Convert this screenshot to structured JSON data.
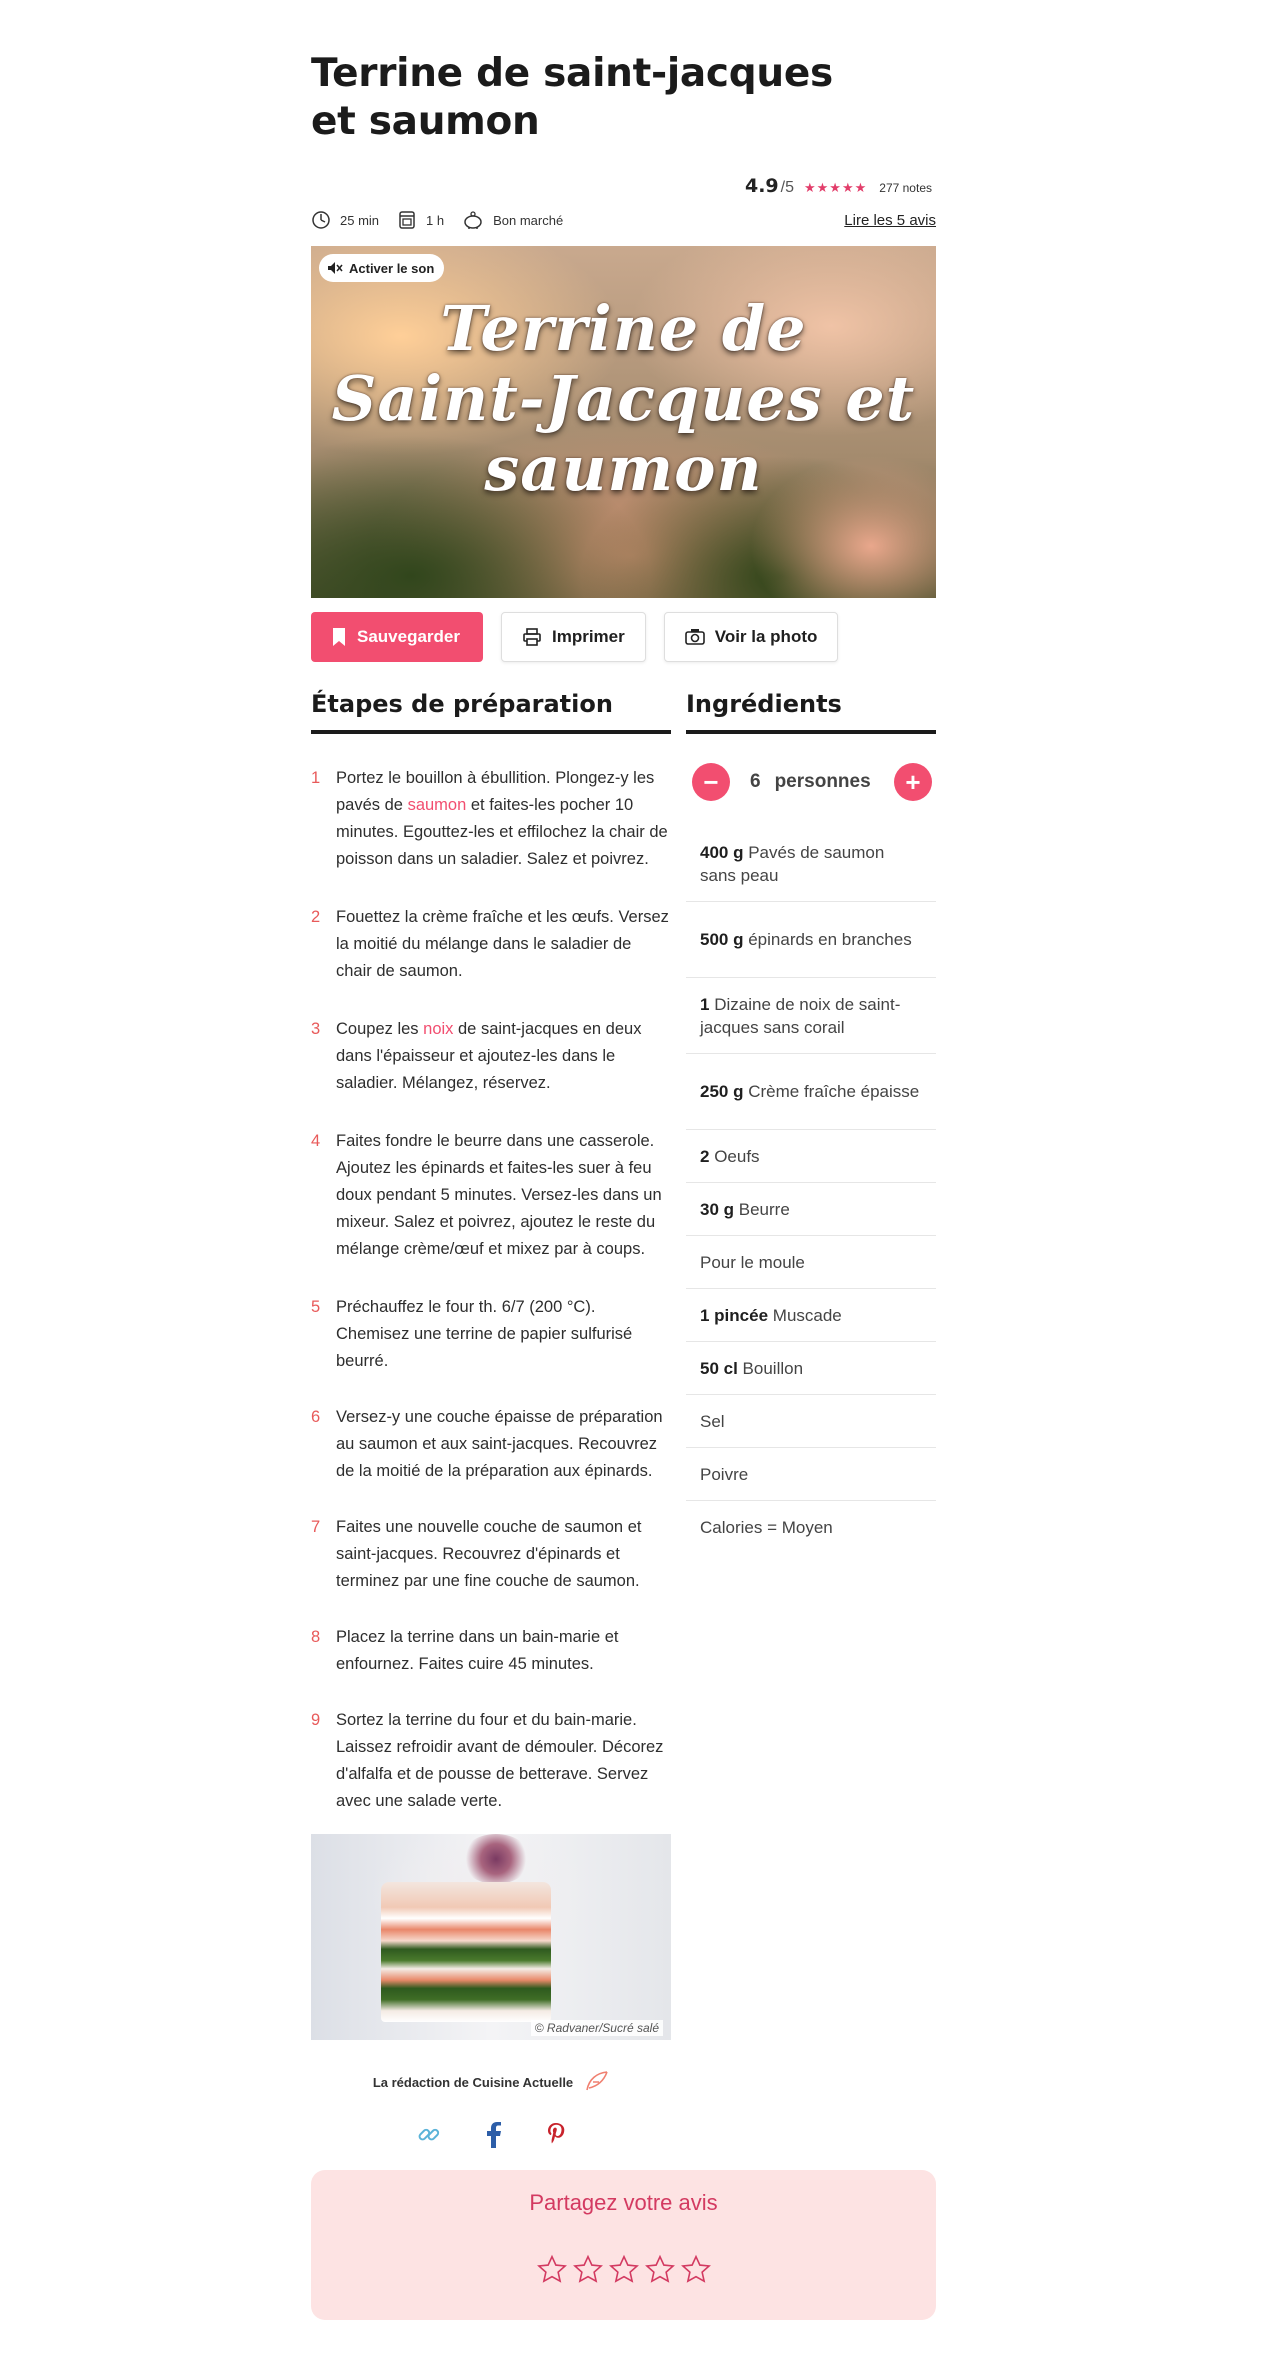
{
  "recipe": {
    "title": "Terrine de saint-jacques et saumon",
    "rating": {
      "score": "4.9",
      "out_of": "/5",
      "stars_count": 5,
      "notes": "277 notes"
    },
    "meta": {
      "prep_time": "25 min",
      "cook_time": "1 h",
      "price": "Bon marché",
      "reviews_link": "Lire les 5 avis"
    }
  },
  "video": {
    "sound_button": "Activer le son",
    "overlay_title": "Terrine de Saint-Jacques et saumon",
    "overlay_lines": [
      "Terrine de",
      "Saint-Jacques et",
      "saumon"
    ]
  },
  "actions": {
    "save": "Sauvegarder",
    "print": "Imprimer",
    "photo": "Voir la photo"
  },
  "preparation": {
    "heading": "Étapes de préparation",
    "steps": [
      {
        "n": "1",
        "before": "Portez le bouillon à ébullition. Plongez-y les pavés de ",
        "link": "saumon",
        "after": " et faites-les pocher 10 minutes. Egouttez-les et effilochez la chair de poisson dans un saladier. Salez et poivrez."
      },
      {
        "n": "2",
        "before": "Fouettez la crème fraîche et les œufs. Versez la moitié du mélange dans le saladier de chair de saumon.",
        "link": "",
        "after": ""
      },
      {
        "n": "3",
        "before": "Coupez les ",
        "link": "noix",
        "after": " de saint-jacques en deux dans l'épaisseur et ajoutez-les dans le saladier. Mélangez, réservez."
      },
      {
        "n": "4",
        "before": "Faites fondre le beurre dans une casserole. Ajoutez les épinards et faites-les suer à feu doux pendant 5 minutes. Versez-les dans un mixeur. Salez et poivrez, ajoutez le reste du mélange crème/œuf et mixez par à coups.",
        "link": "",
        "after": ""
      },
      {
        "n": "5",
        "before": "Préchauffez le four th. 6/7 (200 °C). Chemisez une terrine de papier sulfurisé beurré.",
        "link": "",
        "after": ""
      },
      {
        "n": "6",
        "before": "Versez-y une couche épaisse de préparation au saumon et aux saint-jacques. Recouvrez de la moitié de la préparation aux épinards.",
        "link": "",
        "after": ""
      },
      {
        "n": "7",
        "before": "Faites une nouvelle couche de saumon et saint-jacques. Recouvrez d'épinards et terminez par une fine couche de saumon.",
        "link": "",
        "after": ""
      },
      {
        "n": "8",
        "before": "Placez la terrine dans un bain-marie et enfournez. Faites cuire 45 minutes.",
        "link": "",
        "after": ""
      },
      {
        "n": "9",
        "before": "Sortez la terrine du four et du bain-marie. Laissez refroidir avant de démouler. Décorez d'alfalfa et de pousse de betterave. Servez avec une salade verte.",
        "link": "",
        "after": ""
      }
    ]
  },
  "ingredients": {
    "heading": "Ingrédients",
    "servings": {
      "count": "6",
      "label": "personnes",
      "minus": "−",
      "plus": "+"
    },
    "items": [
      {
        "qty": "400 g",
        "name": "Pavés de saumon sans peau",
        "lines": 2
      },
      {
        "qty": "500 g",
        "name": "épinards en branches",
        "lines": 2
      },
      {
        "qty": "1",
        "name": "Dizaine de noix de saint-jacques sans corail",
        "lines": 2
      },
      {
        "qty": "250 g",
        "name": "Crème fraîche épaisse",
        "lines": 2
      },
      {
        "qty": "2",
        "name": "Oeufs",
        "lines": 1
      },
      {
        "qty": "30 g",
        "name": "Beurre",
        "lines": 1
      },
      {
        "qty": "",
        "name": "Pour le moule",
        "lines": 1
      },
      {
        "qty": "1 pincée",
        "name": "Muscade",
        "lines": 1
      },
      {
        "qty": "50 cl",
        "name": "Bouillon",
        "lines": 1
      },
      {
        "qty": "",
        "name": "Sel",
        "lines": 1
      },
      {
        "qty": "",
        "name": "Poivre",
        "lines": 1
      },
      {
        "qty": "",
        "name": "Calories = Moyen",
        "lines": 1
      }
    ]
  },
  "photo": {
    "credit": "© Radvaner/Sucré salé"
  },
  "byline": {
    "author": "La rédaction de Cuisine Actuelle"
  },
  "share": {
    "icons": [
      "link-icon",
      "facebook-icon",
      "pinterest-icon"
    ]
  },
  "review": {
    "heading": "Partagez votre avis",
    "stars": 5
  },
  "colors": {
    "accent": "#f24e70",
    "review_bg": "#fde3e3",
    "step_number": "#e85a5a"
  }
}
